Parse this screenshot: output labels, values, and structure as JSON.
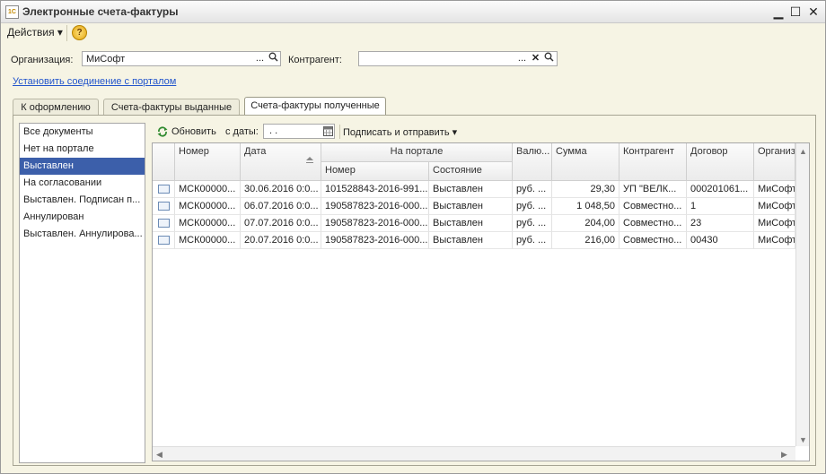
{
  "window": {
    "title": "Электронные счета-фактуры",
    "minimize": "▁",
    "maximize": "☐",
    "close": "✕",
    "app_icon": "1C"
  },
  "menu": {
    "actions": "Действия ▾",
    "help": "?"
  },
  "filters": {
    "org_label": "Организация:",
    "org_value": "МиСофт",
    "counterparty_label": "Контрагент:",
    "counterparty_value": "",
    "dots": "...",
    "clear": "✕",
    "search": "🔍"
  },
  "portal_link": "Установить соединение с порталом",
  "tabs": [
    {
      "label": "К оформлению"
    },
    {
      "label": "Счета-фактуры выданные"
    },
    {
      "label": "Счета-фактуры полученные",
      "active": true
    }
  ],
  "status_filter": [
    "Все документы",
    "Нет на портале",
    "Выставлен",
    "На согласовании",
    "Выставлен. Подписан п...",
    "Аннулирован",
    "Выставлен. Аннулирова..."
  ],
  "status_selected_index": 2,
  "toolbar": {
    "refresh": "Обновить",
    "from_date_label": "с даты:",
    "date_value": " .  .",
    "sign_send": "Подписать и отправить ▾"
  },
  "table": {
    "headers": {
      "number": "Номер",
      "date": "Дата",
      "portal": "На портале",
      "portal_number": "Номер",
      "portal_state": "Состояние",
      "currency": "Валю...",
      "sum": "Сумма",
      "counterparty": "Контрагент",
      "contract": "Договор",
      "org": "Организ"
    },
    "rows": [
      {
        "number": "МСК00000...",
        "date": "30.06.2016 0:0...",
        "portal_number": "101528843-2016-991...",
        "state": "Выставлен",
        "currency": "руб. ...",
        "sum": "29,30",
        "counterparty": "УП \"ВЕЛК...",
        "contract": "000201061...",
        "org": "МиСофт"
      },
      {
        "number": "МСК00000...",
        "date": "06.07.2016 0:0...",
        "portal_number": "190587823-2016-000...",
        "state": "Выставлен",
        "currency": "руб. ...",
        "sum": "1 048,50",
        "counterparty": "Совместно...",
        "contract": "1",
        "org": "МиСофт"
      },
      {
        "number": "МСК00000...",
        "date": "07.07.2016 0:0...",
        "portal_number": "190587823-2016-000...",
        "state": "Выставлен",
        "currency": "руб. ...",
        "sum": "204,00",
        "counterparty": "Совместно...",
        "contract": "23",
        "org": "МиСофт"
      },
      {
        "number": "МСК00000...",
        "date": "20.07.2016 0:0...",
        "portal_number": "190587823-2016-000...",
        "state": "Выставлен",
        "currency": "руб. ...",
        "sum": "216,00",
        "counterparty": "Совместно...",
        "contract": "00430",
        "org": "МиСофт"
      }
    ]
  },
  "colors": {
    "selection": "#3c5faa",
    "link": "#2255cc",
    "background": "#f6f4e4"
  }
}
